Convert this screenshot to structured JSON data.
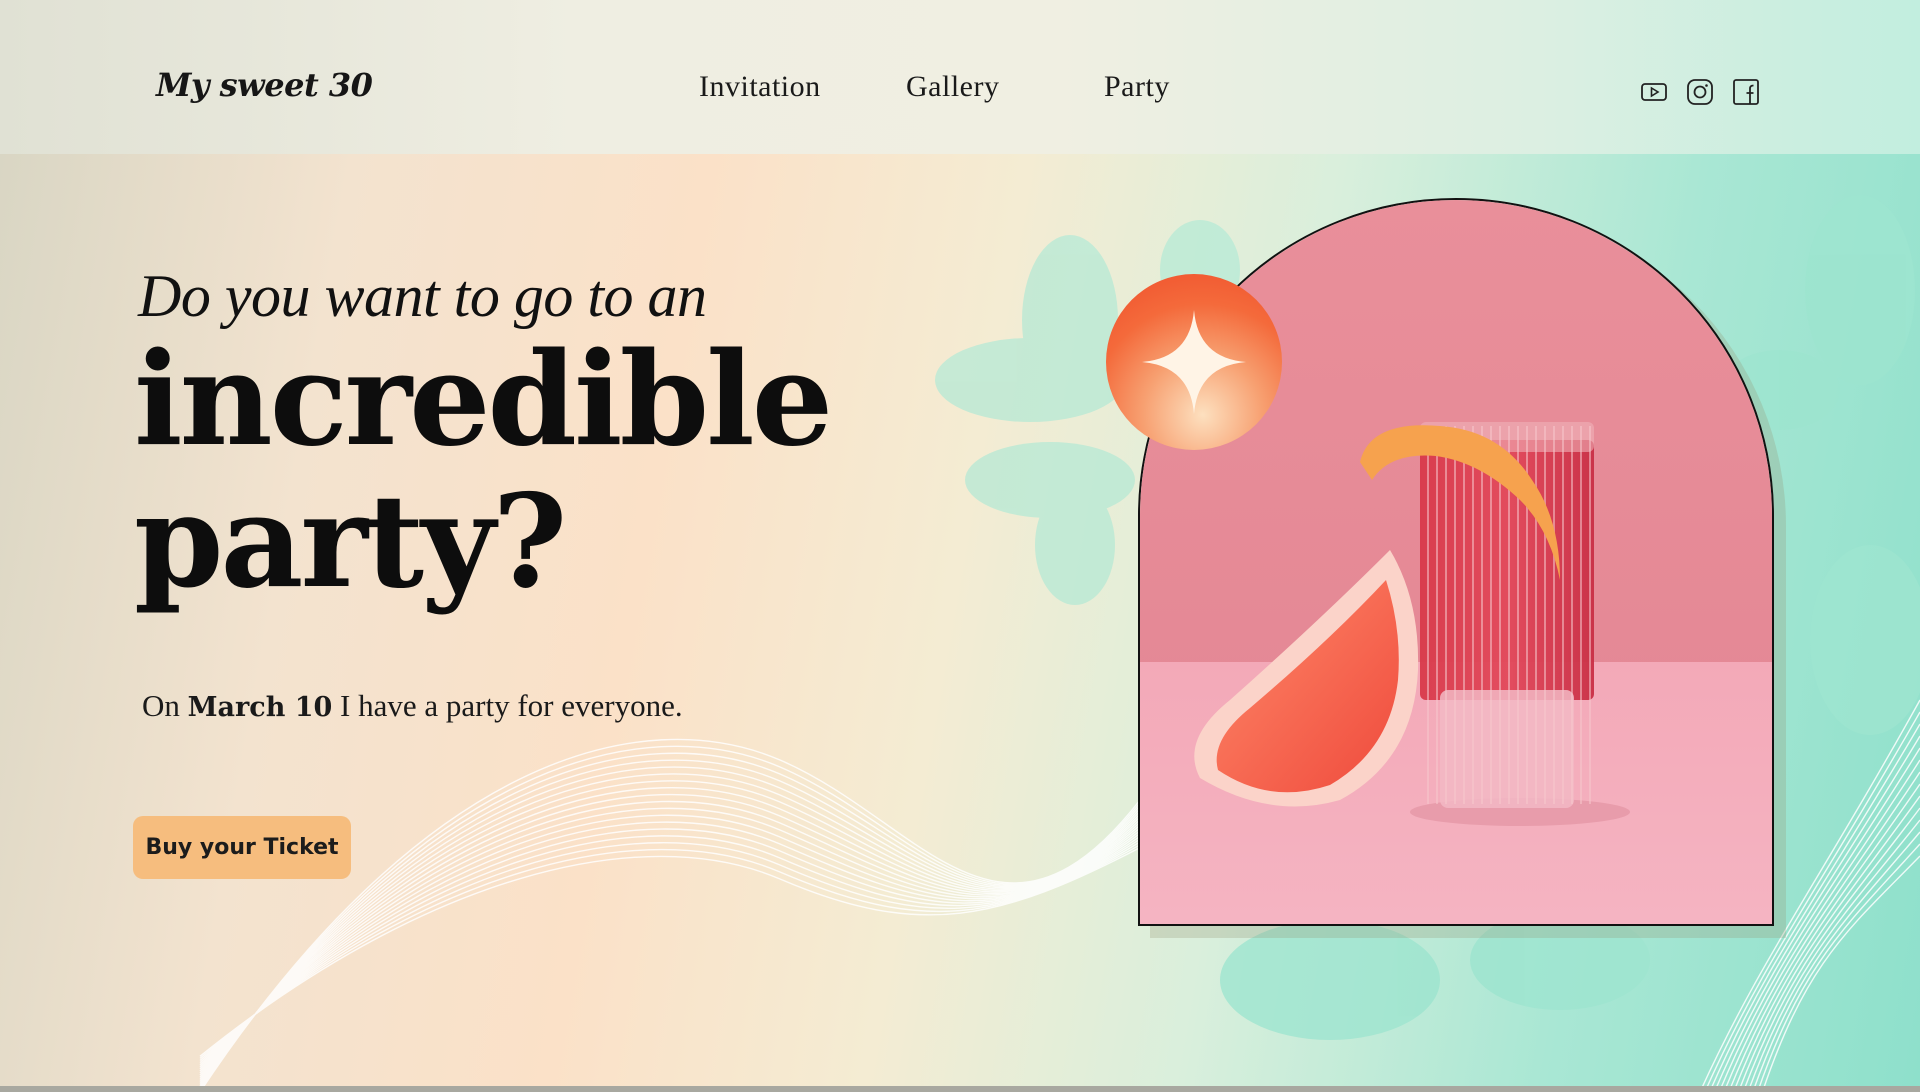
{
  "brand": {
    "logo": "My sweet 30"
  },
  "nav": {
    "items": [
      {
        "label": "Invitation"
      },
      {
        "label": "Gallery"
      },
      {
        "label": "Party"
      }
    ]
  },
  "socials": [
    {
      "icon": "youtube-icon"
    },
    {
      "icon": "instagram-icon"
    },
    {
      "icon": "facebook-icon"
    }
  ],
  "hero": {
    "line_small": "Do you want to go to an",
    "line_big_1": "incredible",
    "line_big_2": "party?",
    "sub_prefix": "On",
    "sub_date": "March 10",
    "sub_suffix": "I have a party for everyone.",
    "cta_label": "Buy your Ticket"
  },
  "image": {
    "subject": "grapefruit cocktail in ribbed glass with grapefruit wedge",
    "badge_icon": "sparkle-icon"
  },
  "colors": {
    "cta": "#f6bd7e",
    "accent_mint": "#8ee0cb",
    "badge": "#ef4e2b",
    "photo_backdrop": "#e9909b"
  }
}
